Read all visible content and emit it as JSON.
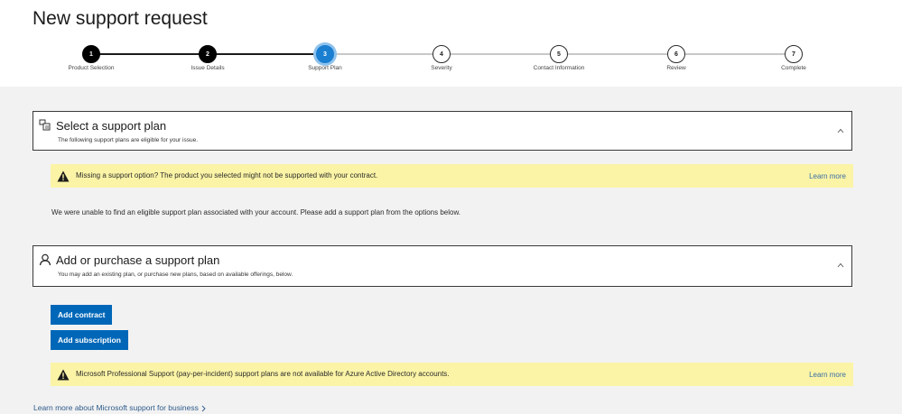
{
  "page": {
    "title": "New support request"
  },
  "stepper": {
    "steps": [
      {
        "number": "1",
        "label": "Product Selection",
        "state": "done"
      },
      {
        "number": "2",
        "label": "Issue Details",
        "state": "done"
      },
      {
        "number": "3",
        "label": "Support Plan",
        "state": "current"
      },
      {
        "number": "4",
        "label": "Severity",
        "state": "todo"
      },
      {
        "number": "5",
        "label": "Contact Information",
        "state": "todo"
      },
      {
        "number": "6",
        "label": "Review",
        "state": "todo"
      },
      {
        "number": "7",
        "label": "Complete",
        "state": "todo"
      }
    ]
  },
  "select_plan": {
    "title": "Select a support plan",
    "subtitle": "The following support plans are eligible for your issue.",
    "icon": "support-plan-icon"
  },
  "warning1": {
    "text": "Missing a support option? The product you selected might not be supported with your contract.",
    "link": "Learn more",
    "icon": "warning-icon"
  },
  "info": {
    "text": "We were unable to find an eligible support plan associated with your account. Please add a support plan from the options below."
  },
  "add_plan": {
    "title": "Add or purchase a support plan",
    "subtitle": "You may add an existing plan, or purchase new plans, based on available offerings, below.",
    "icon": "person-icon"
  },
  "buttons": {
    "add_contract": "Add contract",
    "add_subscription": "Add subscription"
  },
  "warning2": {
    "text": "Microsoft Professional Support (pay-per-incident) support plans are not available for Azure Active Directory accounts.",
    "link": "Learn more",
    "icon": "warning-icon"
  },
  "footer": {
    "link": "Learn more about Microsoft support for business"
  },
  "colors": {
    "accent": "#0067b8",
    "current_step": "#1a7ed1",
    "banner": "#fbf4a6",
    "background": "#f2f2f2"
  }
}
